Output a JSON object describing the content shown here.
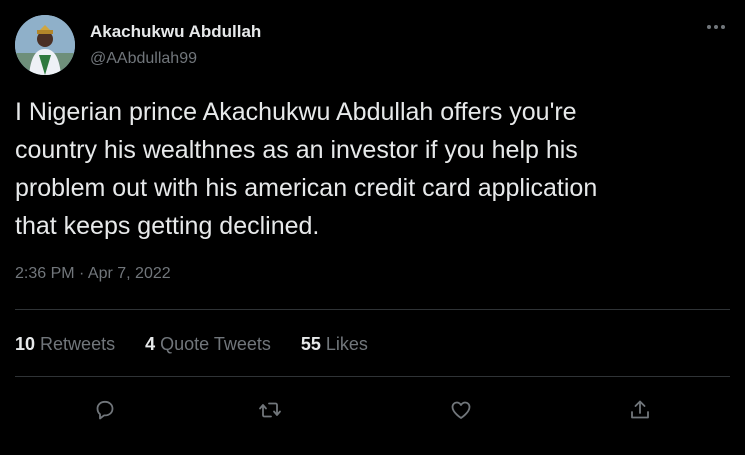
{
  "author": {
    "display_name": "Akachukwu Abdullah",
    "handle": "@AAbdullah99",
    "avatar_icon": "user-avatar"
  },
  "menu_icon": "more-icon",
  "tweet": {
    "text": "I Nigerian prince Akachukwu Abdullah offers you're\ncountry his wealthnes as an investor if you help his\nproblem out with his american credit card application\nthat keeps getting declined.",
    "timestamp": "2:36 PM · Apr 7, 2022"
  },
  "stats": {
    "retweets": {
      "count": "10",
      "label": "Retweets"
    },
    "quote_tweets": {
      "count": "4",
      "label": "Quote Tweets"
    },
    "likes": {
      "count": "55",
      "label": "Likes"
    }
  },
  "actions": [
    "reply-icon",
    "retweet-icon",
    "like-icon",
    "share-icon"
  ],
  "colors": {
    "background": "#000000",
    "primary_text": "#e7e9ea",
    "secondary_text": "#71767b",
    "divider": "#2f3336"
  }
}
